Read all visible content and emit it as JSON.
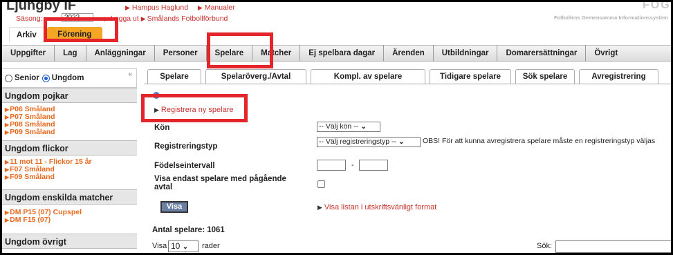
{
  "header": {
    "club_name": "Ljungby IF",
    "user_link": "Hampus Haglund",
    "manual_link": "Manualer",
    "season_label": "Säsong:",
    "season_value": "2022",
    "logout_link": "Logga ut",
    "district_link": "Smålands Fotbollförbund",
    "logo_text": "FOGIS",
    "logo_subtitle": "Fotbollens Gemensamma Informationssystem"
  },
  "top_tabs": [
    {
      "label": "Arkiv"
    },
    {
      "label": "Förening"
    }
  ],
  "nav": [
    {
      "label": "Uppgifter"
    },
    {
      "label": "Lag"
    },
    {
      "label": "Anläggningar"
    },
    {
      "label": "Personer"
    },
    {
      "label": "Spelare"
    },
    {
      "label": "Matcher"
    },
    {
      "label": "Ej spelbara dagar"
    },
    {
      "label": "Ärenden"
    },
    {
      "label": "Utbildningar"
    },
    {
      "label": "Domarersättningar"
    },
    {
      "label": "Övrigt"
    }
  ],
  "sidebar": {
    "radio_senior": "Senior",
    "radio_ungdom": "Ungdom",
    "selected": "Ungdom",
    "collapse": "«",
    "sections": [
      {
        "title": "Ungdom pojkar",
        "items": [
          "P06 Småland",
          "P07 Småland",
          "P08 Småland",
          "P09 Småland"
        ]
      },
      {
        "title": "Ungdom flickor",
        "items": [
          "11 mot 11 - Flickor 15 år",
          "F07 Småland",
          "F09 Småland"
        ]
      },
      {
        "title": "Ungdom enskilda matcher",
        "items": [
          "DM P15 (07) Cupspel",
          "DM F15 (07)"
        ]
      },
      {
        "title": "Ungdom övrigt",
        "items": []
      }
    ]
  },
  "content_tabs": [
    {
      "label": "Spelare"
    },
    {
      "label": "Spelaröverg./Avtal"
    },
    {
      "label": "Kompl. av spelare"
    },
    {
      "label": "Tidigare spelare"
    },
    {
      "label": "Sök spelare"
    },
    {
      "label": "Avregistrering"
    }
  ],
  "form": {
    "register_link": "Registrera ny spelare",
    "kon_label": "Kön",
    "kon_value": "-- Välj kön --",
    "regtyp_label": "Registreringstyp",
    "regtyp_value": "-- Välj registreringstyp --",
    "regtyp_note": "OBS! För att kunna avregistrera spelare måste en registreringstyp väljas",
    "fodelse_label": "Födelseintervall",
    "range_dash": "-",
    "avtal_label": "Visa endast spelare med pågående avtal",
    "visa_button": "Visa",
    "print_link": "Visa listan i utskriftsvänligt format"
  },
  "list": {
    "count_text": "Antal spelare: 1061",
    "show_label": "Visa",
    "page_size": "10",
    "rows_label": "rader",
    "search_label": "Sök:"
  },
  "colors": {
    "accent_orange": "#f5a623",
    "link_red": "#c8322d",
    "side_link_orange": "#e8691f",
    "annotation_red": "#e4262c"
  }
}
